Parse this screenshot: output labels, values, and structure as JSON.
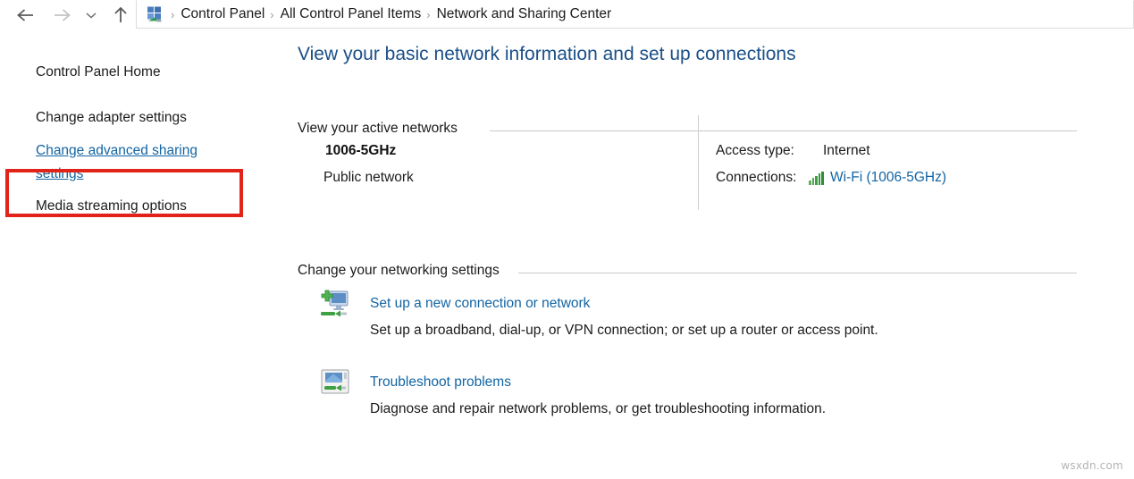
{
  "window": {
    "navigation": {
      "back_label": "Back",
      "forward_label": "Forward",
      "recent_label": "Recent locations",
      "up_label": "Up one level"
    },
    "breadcrumb": {
      "icon": "control-panel-icon",
      "separator": "›",
      "items": [
        "Control Panel",
        "All Control Panel Items",
        "Network and Sharing Center"
      ]
    }
  },
  "sidebar": {
    "items": [
      {
        "label": "Control Panel Home",
        "state": "normal"
      },
      {
        "label": "Change adapter settings",
        "state": "normal"
      },
      {
        "label": "Change advanced sharing settings",
        "state": "link-highlighted"
      },
      {
        "label": "Media streaming options",
        "state": "normal"
      }
    ],
    "annotation": {
      "type": "red-rectangle",
      "color": "#E2231A",
      "targets": "Change advanced sharing settings"
    }
  },
  "main": {
    "page_title": "View your basic network information and set up connections",
    "sections": [
      {
        "heading": "View your active networks"
      },
      {
        "heading": "Change your networking settings"
      }
    ],
    "active_network": {
      "name": "1006-5GHz",
      "type": "Public network",
      "details": [
        {
          "label": "Access type:",
          "value": "Internet"
        },
        {
          "label": "Connections:",
          "value": "Wi-Fi (1006-5GHz)",
          "icon": "wifi-signal-bars-icon"
        }
      ]
    },
    "actions": [
      {
        "icon": "setup-new-connection-icon",
        "link": "Set up a new connection or network",
        "description": "Set up a broadband, dial-up, or VPN connection; or set up a router or access point."
      },
      {
        "icon": "troubleshoot-icon",
        "link": "Troubleshoot problems",
        "description": "Diagnose and repair network problems, or get troubleshooting information."
      }
    ]
  },
  "watermark": "wsxdn.com",
  "colors": {
    "heading_blue": "#1A4F88",
    "link_blue": "#1264A3",
    "annotation_red": "#E2231A",
    "signal_green": "#2D8E36"
  }
}
